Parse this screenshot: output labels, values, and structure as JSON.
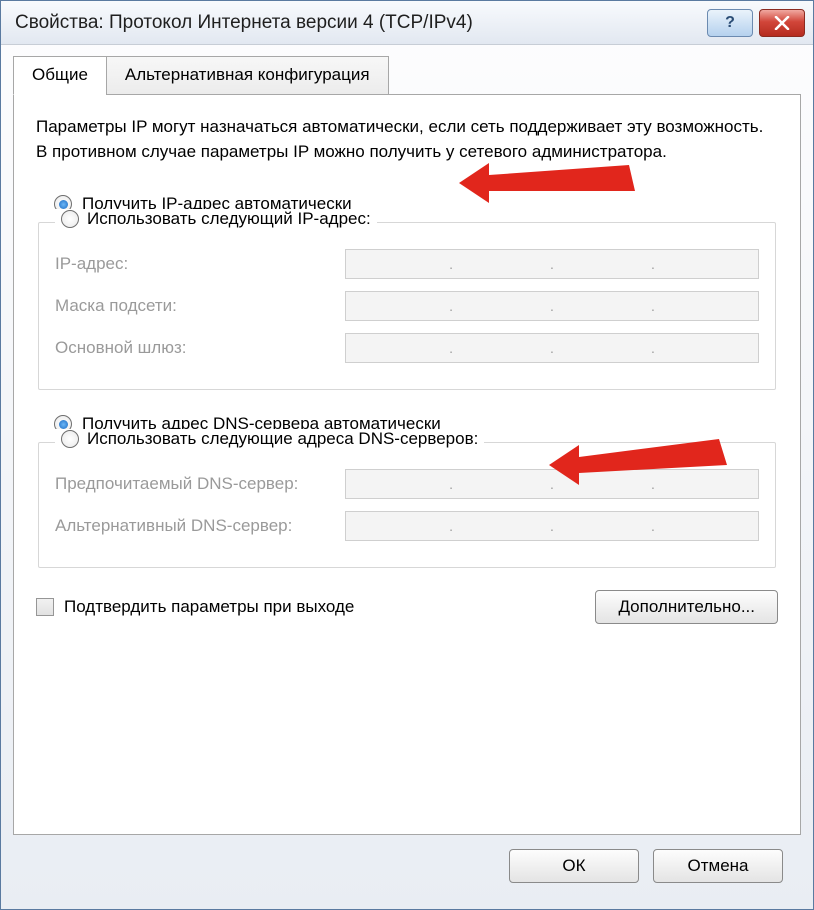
{
  "title": "Свойства: Протокол Интернета версии 4 (TCP/IPv4)",
  "tabs": {
    "general": "Общие",
    "alternative": "Альтернативная конфигурация"
  },
  "description": "Параметры IP могут назначаться автоматически, если сеть поддерживает эту возможность. В противном случае параметры IP можно получить у сетевого администратора.",
  "ip": {
    "auto_label": "Получить IP-адрес автоматически",
    "manual_label": "Использовать следующий IP-адрес:",
    "field_ip": "IP-адрес:",
    "field_mask": "Маска подсети:",
    "field_gateway": "Основной шлюз:"
  },
  "dns": {
    "auto_label": "Получить адрес DNS-сервера автоматически",
    "manual_label": "Использовать следующие адреса DNS-серверов:",
    "field_preferred": "Предпочитаемый DNS-сервер:",
    "field_alternate": "Альтернативный DNS-сервер:"
  },
  "confirm_on_exit_label": "Подтвердить параметры при выходе",
  "advanced_button": "Дополнительно...",
  "ok_button": "ОК",
  "cancel_button": "Отмена"
}
